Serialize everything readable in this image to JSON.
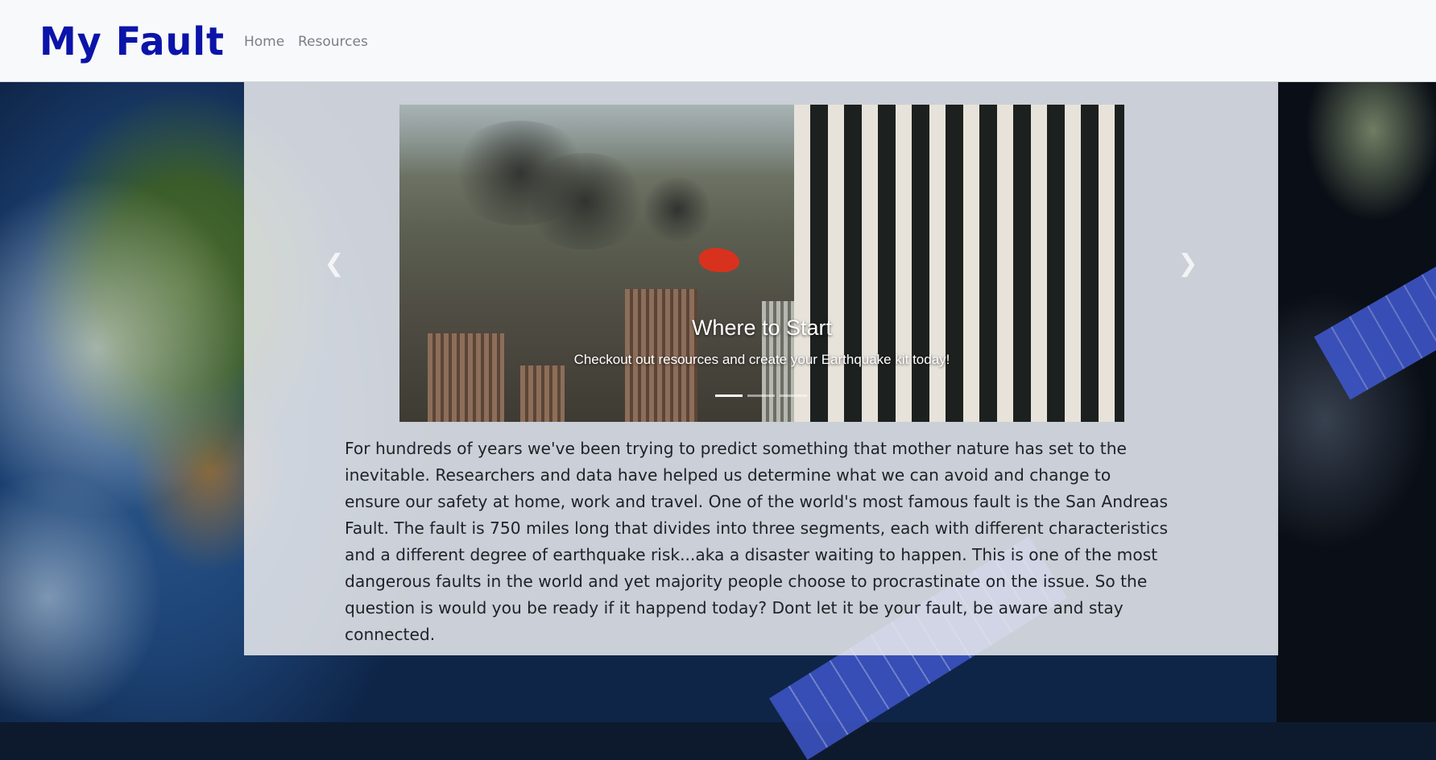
{
  "navbar": {
    "brand": "My Fault",
    "links": [
      {
        "label": "Home"
      },
      {
        "label": "Resources"
      }
    ]
  },
  "carousel": {
    "slide": {
      "title": "Where to Start",
      "text": "Checkout out resources and create your Earthquake kit today!"
    },
    "indicators": [
      {
        "active": true
      },
      {
        "active": false
      },
      {
        "active": false
      }
    ],
    "prev_icon": "chevron-left-icon",
    "next_icon": "chevron-right-icon"
  },
  "main": {
    "paragraph": "For hundreds of years we've been trying to predict something that mother nature has set to the inevitable. Researchers and data have helped us determine what we can avoid and change to ensure our safety at home, work and travel. One of the world's most famous fault is the San Andreas Fault. The fault is 750 miles long that divides into three segments, each with different characteristics and a different degree of earthquake risk...aka a disaster waiting to happen. This is one of the most dangerous faults in the world and yet majority people choose to procrastinate on the issue. So the question is would you be ready if it happend today? Dont let it be your fault, be aware and stay connected."
  },
  "colors": {
    "brand": "#0b14a8",
    "navbar_bg": "#f8f9fb",
    "nav_link": "#7b7f84",
    "panel_bg": "#e8e9ed"
  }
}
